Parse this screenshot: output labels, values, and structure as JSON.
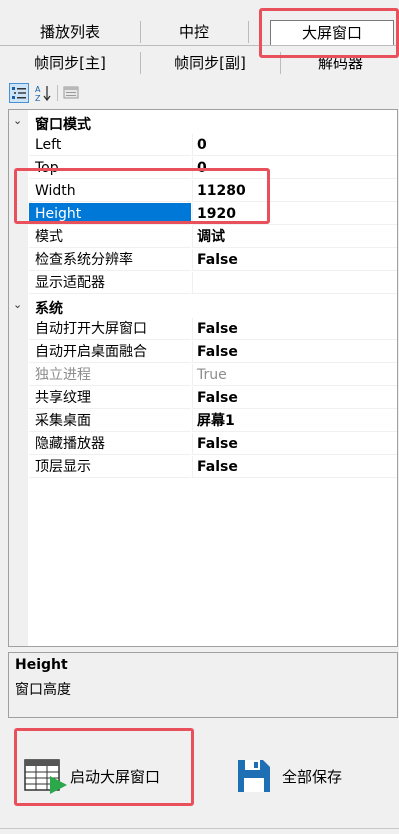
{
  "tabs_row1": [
    {
      "label": "播放列表"
    },
    {
      "label": "中控"
    },
    {
      "label": "大屏窗口",
      "active": true
    }
  ],
  "tabs_row2": [
    {
      "label": "帧同步[主]"
    },
    {
      "label": "帧同步[副]"
    },
    {
      "label": "解码器"
    }
  ],
  "toolbar": {
    "categorized_icon": "categorized-icon",
    "alphabetical_icon": "sort-az-icon",
    "property_pages_icon": "property-pages-icon"
  },
  "property_grid": {
    "categories": [
      {
        "name": "窗口模式",
        "properties": [
          {
            "name": "Left",
            "value": "0"
          },
          {
            "name": "Top",
            "value": "0"
          },
          {
            "name": "Width",
            "value": "11280"
          },
          {
            "name": "Height",
            "value": "1920",
            "selected": true
          },
          {
            "name": "模式",
            "value": "调试"
          },
          {
            "name": "检查系统分辨率",
            "value": "False"
          },
          {
            "name": "显示适配器",
            "value": ""
          }
        ]
      },
      {
        "name": "系统",
        "properties": [
          {
            "name": "自动打开大屏窗口",
            "value": "False"
          },
          {
            "name": "自动开启桌面融合",
            "value": "False"
          },
          {
            "name": "独立进程",
            "value": "True",
            "disabled": true
          },
          {
            "name": "共享纹理",
            "value": "False"
          },
          {
            "name": "采集桌面",
            "value": "屏幕1"
          },
          {
            "name": "隐藏播放器",
            "value": "False"
          },
          {
            "name": "顶层显示",
            "value": "False"
          }
        ]
      }
    ]
  },
  "description": {
    "title": "Height",
    "text": "窗口高度"
  },
  "actions": {
    "start_label": "启动大屏窗口",
    "save_label": "全部保存"
  },
  "colors": {
    "highlight": "#0078d7",
    "annotation_red": "#e8505b",
    "play_green": "#2aa84a",
    "save_blue": "#1f6fb4"
  }
}
